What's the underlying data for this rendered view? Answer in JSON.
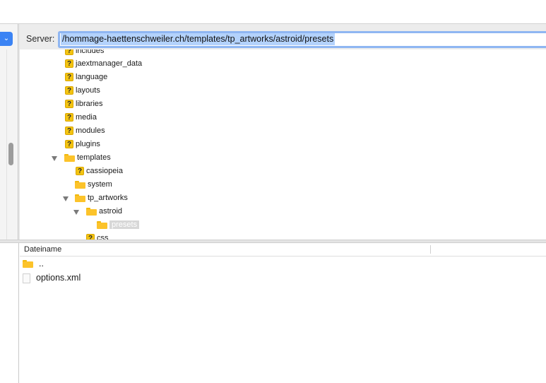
{
  "server": {
    "label": "Server:",
    "path": "/hommage-haettenschweiler.ch/templates/tp_artworks/astroid/presets"
  },
  "tree": [
    {
      "label": "includes",
      "icon": "unknown-icon"
    },
    {
      "label": "jaextmanager_data",
      "icon": "unknown-icon"
    },
    {
      "label": "language",
      "icon": "unknown-icon"
    },
    {
      "label": "layouts",
      "icon": "unknown-icon"
    },
    {
      "label": "libraries",
      "icon": "unknown-icon"
    },
    {
      "label": "media",
      "icon": "unknown-icon"
    },
    {
      "label": "modules",
      "icon": "unknown-icon"
    },
    {
      "label": "plugins",
      "icon": "unknown-icon"
    },
    {
      "label": "templates",
      "icon": "folder-icon",
      "expanded": true
    },
    {
      "label": "cassiopeia",
      "icon": "unknown-icon"
    },
    {
      "label": "system",
      "icon": "folder-icon"
    },
    {
      "label": "tp_artworks",
      "icon": "folder-icon",
      "expanded": true
    },
    {
      "label": "astroid",
      "icon": "folder-icon",
      "expanded": true
    },
    {
      "label": "presets",
      "icon": "folder-icon",
      "selected": true
    },
    {
      "label": "css",
      "icon": "unknown-icon"
    }
  ],
  "filelist": {
    "column_name": "Dateiname",
    "items": [
      {
        "name": "..",
        "icon": "folder-icon"
      },
      {
        "name": "options.xml",
        "icon": "file-icon"
      }
    ]
  },
  "colors": {
    "accent": "#3b83f4",
    "folder": "#fcc32a",
    "selection": "#b3d2fc"
  }
}
